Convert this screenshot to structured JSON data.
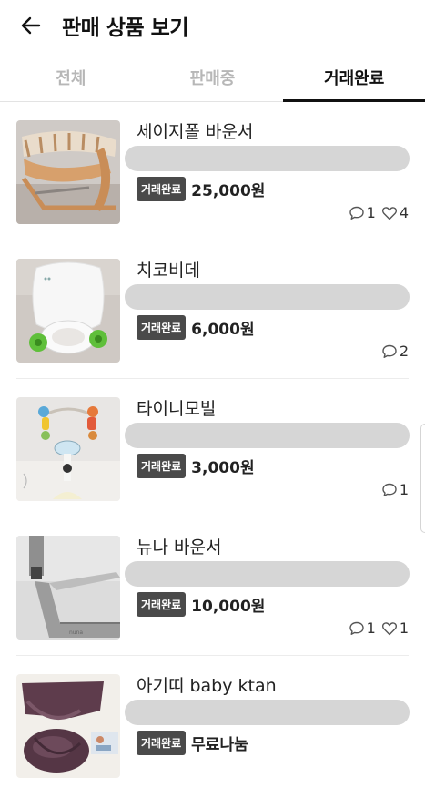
{
  "header": {
    "title": "판매 상품 보기"
  },
  "tabs": [
    {
      "label": "전체",
      "active": false
    },
    {
      "label": "판매중",
      "active": false
    },
    {
      "label": "거래완료",
      "active": true
    }
  ],
  "items": [
    {
      "name": "세이지폴 바운서",
      "status": "거래완료",
      "price": "25,000원",
      "comments": "1",
      "likes": "4",
      "image": "wooden-bouncer"
    },
    {
      "name": "치코비데",
      "status": "거래완료",
      "price": "6,000원",
      "comments": "2",
      "likes": null,
      "image": "white-bidet"
    },
    {
      "name": "타이니모빌",
      "status": "거래완료",
      "price": "3,000원",
      "comments": "1",
      "likes": null,
      "image": "baby-mobile"
    },
    {
      "name": "뉴나 바운서",
      "status": "거래완료",
      "price": "10,000원",
      "comments": "1",
      "likes": "1",
      "image": "gray-bouncer"
    },
    {
      "name": "아기띠 baby ktan",
      "status": "거래완료",
      "price": "무료나눔",
      "comments": null,
      "likes": null,
      "image": "baby-carrier"
    }
  ],
  "colors": {
    "active_tab": "#111111",
    "inactive_tab": "#b7b7b7",
    "badge_bg": "#4a4a4a",
    "blur_bar": "#d6d6d6"
  }
}
